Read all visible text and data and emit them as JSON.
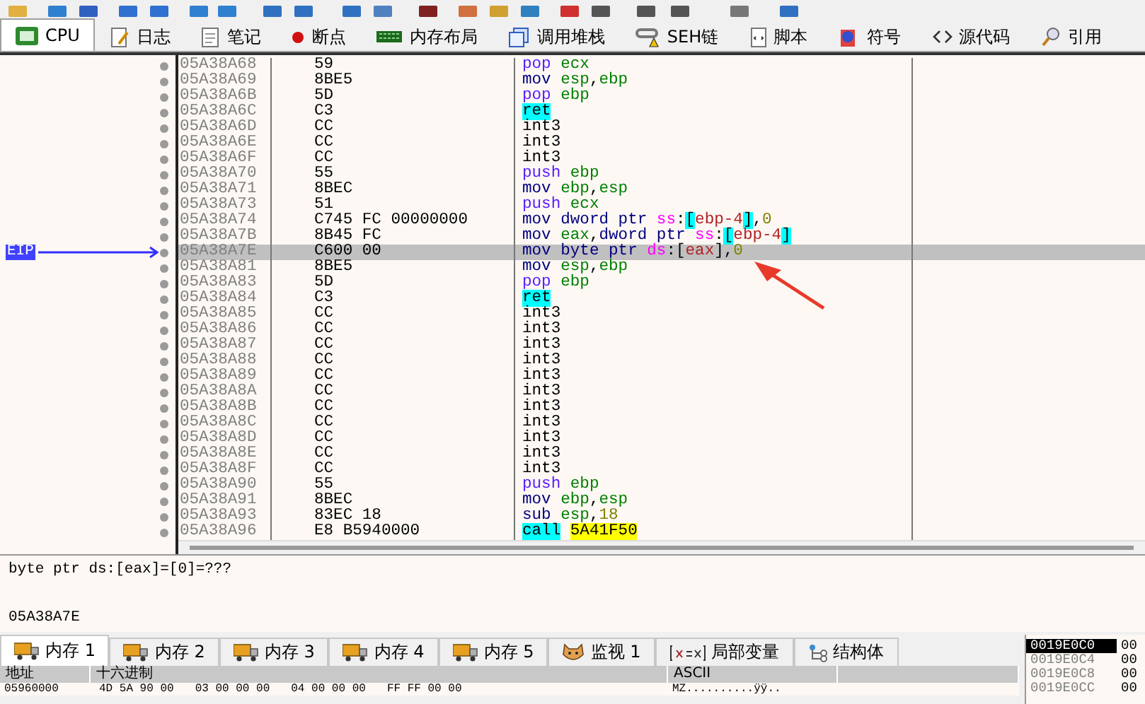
{
  "tabs": [
    {
      "label": "CPU",
      "kind": "chip",
      "selected": true
    },
    {
      "label": "日志",
      "kind": "note",
      "selected": false
    },
    {
      "label": "笔记",
      "kind": "doc",
      "selected": false
    },
    {
      "label": "断点",
      "kind": "dot",
      "selected": false
    },
    {
      "label": "内存布局",
      "kind": "ram",
      "selected": false
    },
    {
      "label": "调用堆栈",
      "kind": "stack",
      "selected": false
    },
    {
      "label": "SEH链",
      "kind": "chain",
      "selected": false
    },
    {
      "label": "脚本",
      "kind": "script",
      "selected": false
    },
    {
      "label": "符号",
      "kind": "ball",
      "selected": false
    },
    {
      "label": "源代码",
      "kind": "code",
      "selected": false
    },
    {
      "label": "引用",
      "kind": "search",
      "selected": false
    }
  ],
  "disassembly": {
    "eip_label": "EIP",
    "rows": [
      {
        "address": "05A38A68",
        "bytes": "59",
        "ins": [
          {
            "text": "pop ",
            "kind": "stack"
          },
          {
            "text": "ecx",
            "kind": "reg"
          }
        ],
        "selected": false
      },
      {
        "address": "05A38A69",
        "bytes": "8BE5",
        "ins": [
          {
            "text": "mov ",
            "kind": "mov"
          },
          {
            "text": "esp",
            "kind": "reg"
          },
          {
            "text": ",",
            "kind": "plain"
          },
          {
            "text": "ebp",
            "kind": "reg"
          }
        ],
        "selected": false
      },
      {
        "address": "05A38A6B",
        "bytes": "5D",
        "ins": [
          {
            "text": "pop ",
            "kind": "stack"
          },
          {
            "text": "ebp",
            "kind": "reg"
          }
        ],
        "selected": false
      },
      {
        "address": "05A38A6C",
        "bytes": "C3",
        "ins": [
          {
            "text": "ret",
            "kind": "flow"
          }
        ],
        "selected": false
      },
      {
        "address": "05A38A6D",
        "bytes": "CC",
        "ins": [
          {
            "text": "int3",
            "kind": "plain"
          }
        ],
        "selected": false
      },
      {
        "address": "05A38A6E",
        "bytes": "CC",
        "ins": [
          {
            "text": "int3",
            "kind": "plain"
          }
        ],
        "selected": false
      },
      {
        "address": "05A38A6F",
        "bytes": "CC",
        "ins": [
          {
            "text": "int3",
            "kind": "plain"
          }
        ],
        "selected": false
      },
      {
        "address": "05A38A70",
        "bytes": "55",
        "ins": [
          {
            "text": "push ",
            "kind": "stack"
          },
          {
            "text": "ebp",
            "kind": "reg"
          }
        ],
        "selected": false
      },
      {
        "address": "05A38A71",
        "bytes": "8BEC",
        "ins": [
          {
            "text": "mov ",
            "kind": "mov"
          },
          {
            "text": "ebp",
            "kind": "reg"
          },
          {
            "text": ",",
            "kind": "plain"
          },
          {
            "text": "esp",
            "kind": "reg"
          }
        ],
        "selected": false
      },
      {
        "address": "05A38A73",
        "bytes": "51",
        "ins": [
          {
            "text": "push ",
            "kind": "stack"
          },
          {
            "text": "ecx",
            "kind": "reg"
          }
        ],
        "selected": false
      },
      {
        "address": "05A38A74",
        "bytes": "C745 FC 00000000",
        "ins": [
          {
            "text": "mov ",
            "kind": "mov"
          },
          {
            "text": "dword ptr ",
            "kind": "mov"
          },
          {
            "text": "ss",
            "kind": "seg"
          },
          {
            "text": ":",
            "kind": "plain"
          },
          {
            "text": "[",
            "kind": "bracket"
          },
          {
            "text": "ebp-4",
            "kind": "mem"
          },
          {
            "text": "]",
            "kind": "bracket"
          },
          {
            "text": ",",
            "kind": "plain"
          },
          {
            "text": "0",
            "kind": "num"
          }
        ],
        "selected": false
      },
      {
        "address": "05A38A7B",
        "bytes": "8B45 FC",
        "ins": [
          {
            "text": "mov ",
            "kind": "mov"
          },
          {
            "text": "eax",
            "kind": "reg"
          },
          {
            "text": ",",
            "kind": "plain"
          },
          {
            "text": "dword ptr ",
            "kind": "mov"
          },
          {
            "text": "ss",
            "kind": "seg"
          },
          {
            "text": ":",
            "kind": "plain"
          },
          {
            "text": "[",
            "kind": "bracket"
          },
          {
            "text": "ebp-4",
            "kind": "mem"
          },
          {
            "text": "]",
            "kind": "bracket"
          }
        ],
        "selected": false
      },
      {
        "address": "05A38A7E",
        "bytes": "C600 00",
        "ins": [
          {
            "text": "mov ",
            "kind": "mov"
          },
          {
            "text": "byte ptr ",
            "kind": "mov"
          },
          {
            "text": "ds",
            "kind": "seg"
          },
          {
            "text": ":",
            "kind": "plain"
          },
          {
            "text": "[",
            "kind": "plain"
          },
          {
            "text": "eax",
            "kind": "mem"
          },
          {
            "text": "]",
            "kind": "plain"
          },
          {
            "text": ",",
            "kind": "plain"
          },
          {
            "text": "0",
            "kind": "num"
          }
        ],
        "selected": true
      },
      {
        "address": "05A38A81",
        "bytes": "8BE5",
        "ins": [
          {
            "text": "mov ",
            "kind": "mov"
          },
          {
            "text": "esp",
            "kind": "reg"
          },
          {
            "text": ",",
            "kind": "plain"
          },
          {
            "text": "ebp",
            "kind": "reg"
          }
        ],
        "selected": false
      },
      {
        "address": "05A38A83",
        "bytes": "5D",
        "ins": [
          {
            "text": "pop ",
            "kind": "stack"
          },
          {
            "text": "ebp",
            "kind": "reg"
          }
        ],
        "selected": false
      },
      {
        "address": "05A38A84",
        "bytes": "C3",
        "ins": [
          {
            "text": "ret",
            "kind": "flow"
          }
        ],
        "selected": false
      },
      {
        "address": "05A38A85",
        "bytes": "CC",
        "ins": [
          {
            "text": "int3",
            "kind": "plain"
          }
        ],
        "selected": false
      },
      {
        "address": "05A38A86",
        "bytes": "CC",
        "ins": [
          {
            "text": "int3",
            "kind": "plain"
          }
        ],
        "selected": false
      },
      {
        "address": "05A38A87",
        "bytes": "CC",
        "ins": [
          {
            "text": "int3",
            "kind": "plain"
          }
        ],
        "selected": false
      },
      {
        "address": "05A38A88",
        "bytes": "CC",
        "ins": [
          {
            "text": "int3",
            "kind": "plain"
          }
        ],
        "selected": false
      },
      {
        "address": "05A38A89",
        "bytes": "CC",
        "ins": [
          {
            "text": "int3",
            "kind": "plain"
          }
        ],
        "selected": false
      },
      {
        "address": "05A38A8A",
        "bytes": "CC",
        "ins": [
          {
            "text": "int3",
            "kind": "plain"
          }
        ],
        "selected": false
      },
      {
        "address": "05A38A8B",
        "bytes": "CC",
        "ins": [
          {
            "text": "int3",
            "kind": "plain"
          }
        ],
        "selected": false
      },
      {
        "address": "05A38A8C",
        "bytes": "CC",
        "ins": [
          {
            "text": "int3",
            "kind": "plain"
          }
        ],
        "selected": false
      },
      {
        "address": "05A38A8D",
        "bytes": "CC",
        "ins": [
          {
            "text": "int3",
            "kind": "plain"
          }
        ],
        "selected": false
      },
      {
        "address": "05A38A8E",
        "bytes": "CC",
        "ins": [
          {
            "text": "int3",
            "kind": "plain"
          }
        ],
        "selected": false
      },
      {
        "address": "05A38A8F",
        "bytes": "CC",
        "ins": [
          {
            "text": "int3",
            "kind": "plain"
          }
        ],
        "selected": false
      },
      {
        "address": "05A38A90",
        "bytes": "55",
        "ins": [
          {
            "text": "push ",
            "kind": "stack"
          },
          {
            "text": "ebp",
            "kind": "reg"
          }
        ],
        "selected": false
      },
      {
        "address": "05A38A91",
        "bytes": "8BEC",
        "ins": [
          {
            "text": "mov ",
            "kind": "mov"
          },
          {
            "text": "ebp",
            "kind": "reg"
          },
          {
            "text": ",",
            "kind": "plain"
          },
          {
            "text": "esp",
            "kind": "reg"
          }
        ],
        "selected": false
      },
      {
        "address": "05A38A93",
        "bytes": "83EC 18",
        "ins": [
          {
            "text": "sub ",
            "kind": "mov"
          },
          {
            "text": "esp",
            "kind": "reg"
          },
          {
            "text": ",",
            "kind": "plain"
          },
          {
            "text": "18",
            "kind": "num"
          }
        ],
        "selected": false
      },
      {
        "address": "05A38A96",
        "bytes": "E8 B5940000",
        "ins": [
          {
            "text": "call",
            "kind": "flow"
          },
          {
            "text": "5A41F50",
            "kind": "addr"
          }
        ],
        "selected": false
      }
    ]
  },
  "info": {
    "lines": [
      "byte ptr ds:[eax]=[0]=???",
      "05A38A7E"
    ]
  },
  "memory_tabs": [
    {
      "label": "内存 1",
      "kind": "truck",
      "selected": true
    },
    {
      "label": "内存 2",
      "kind": "truck",
      "selected": false
    },
    {
      "label": "内存 3",
      "kind": "truck",
      "selected": false
    },
    {
      "label": "内存 4",
      "kind": "truck",
      "selected": false
    },
    {
      "label": "内存 5",
      "kind": "truck",
      "selected": false
    },
    {
      "label": "监视 1",
      "kind": "face",
      "selected": false
    },
    {
      "label": "局部变量",
      "kind": "var",
      "selected": false
    },
    {
      "label": "结构体",
      "kind": "tree",
      "selected": false
    }
  ],
  "memory": {
    "columns": [
      "地址",
      "十六进制",
      "ASCII"
    ],
    "rows": [
      {
        "address": "05960000",
        "hex": [
          "4D 5A 90 00",
          "03 00 00 00",
          "04 00 00 00",
          "FF FF 00 00"
        ],
        "ascii": "MZ..........ÿÿ.."
      }
    ]
  },
  "stack": {
    "rows": [
      {
        "address": "0019E0C0",
        "value": "00",
        "selected": true
      },
      {
        "address": "0019E0C4",
        "value": "00",
        "selected": false
      },
      {
        "address": "0019E0C8",
        "value": "00",
        "selected": false
      },
      {
        "address": "0019E0CC",
        "value": "00",
        "selected": false
      }
    ]
  }
}
